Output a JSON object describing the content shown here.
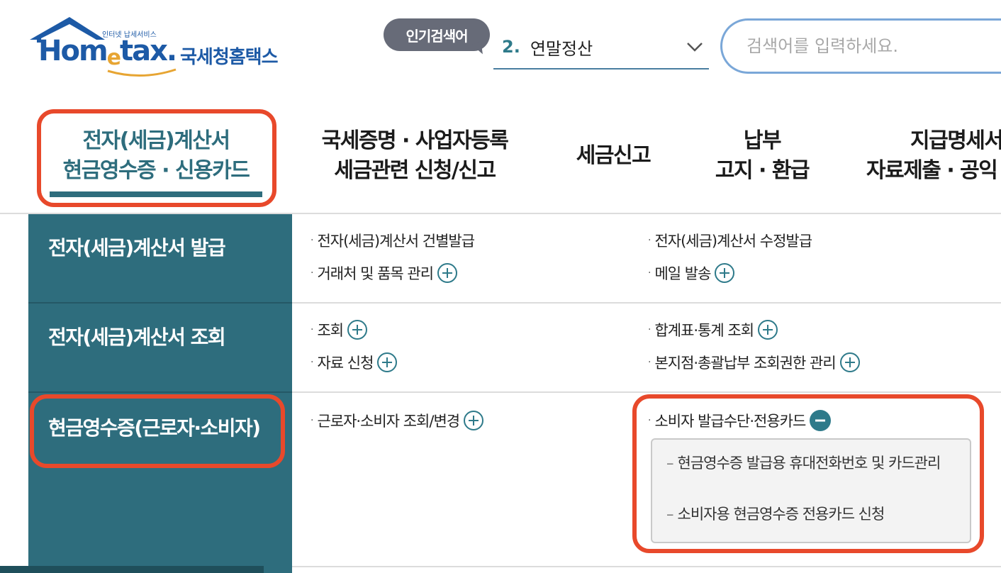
{
  "header": {
    "logo": {
      "sub": "인터넷 납세서비스",
      "brand_main": "Hom",
      "brand_e": "e",
      "brand_tail": "tax.",
      "name": "국세청홈택스"
    },
    "popular": {
      "badge": "인기검색어",
      "rank": "2.",
      "term": "연말정산"
    },
    "search": {
      "placeholder": "검색어를 입력하세요."
    }
  },
  "nav": {
    "items": [
      {
        "line1": "전자(세금)계산서",
        "line2": "현금영수증 · 신용카드"
      },
      {
        "line1": "국세증명 · 사업자등록",
        "line2": "세금관련 신청/신고"
      },
      {
        "line1": "세금신고",
        "line2": ""
      },
      {
        "line1": "납부",
        "line2": "고지 · 환급"
      },
      {
        "line1": "지급명세서",
        "line2": "자료제출 · 공익"
      }
    ]
  },
  "menu": {
    "sections": [
      {
        "title": "전자(세금)계산서 발급",
        "col1": [
          "전자(세금)계산서 건별발급",
          "거래처 및 품목 관리"
        ],
        "col2": [
          "전자(세금)계산서 수정발급",
          "메일 발송"
        ]
      },
      {
        "title": "전자(세금)계산서 조회",
        "col1": [
          "조회",
          "자료 신청"
        ],
        "col2": [
          "합계표·통계 조회",
          "본지점·총괄납부 조회권한 관리"
        ]
      },
      {
        "title": "현금영수증(근로자·소비자)",
        "col1": [
          "근로자·소비자 조회/변경"
        ],
        "col2": [
          "소비자 발급수단·전용카드"
        ],
        "sub": [
          "현금영수증 발급용 휴대전화번호 및 카드관리",
          "소비자용 현금영수증 전용카드 신청"
        ]
      }
    ]
  },
  "colors": {
    "accent": "#2e6d7d",
    "highlight": "#e8492b",
    "brand": "#1d5aa6"
  }
}
